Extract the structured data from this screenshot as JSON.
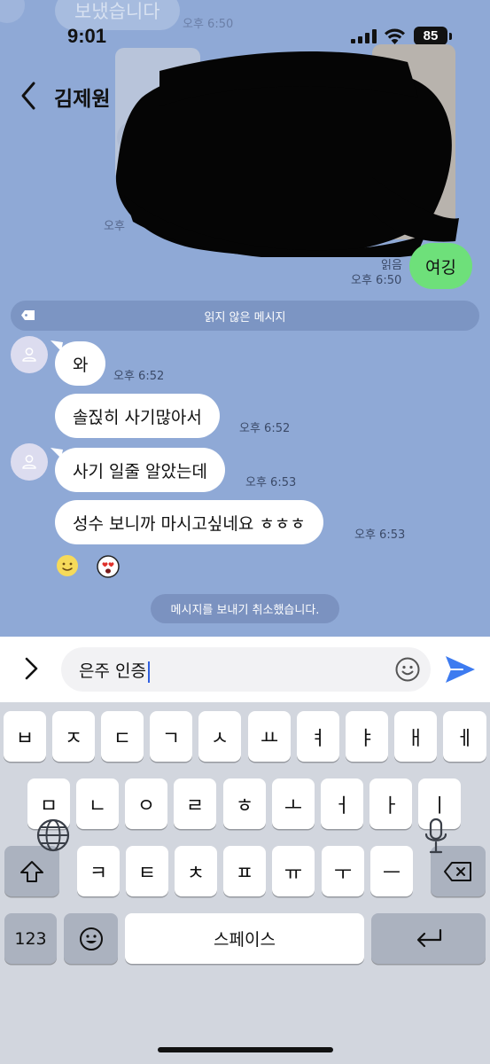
{
  "status_bar": {
    "time": "9:01",
    "battery": "85"
  },
  "header": {
    "title": "김제원"
  },
  "background_faint": {
    "top_bubble_text": "보냈습니다",
    "top_time": "오후 6:50",
    "left_time": "오후"
  },
  "sent_message": {
    "read_label": "읽음",
    "time": "오후 6:50",
    "text": "여깅"
  },
  "unread_divider": "읽지 않은 메시지",
  "messages": [
    {
      "text": "와",
      "time": "오후 6:52"
    },
    {
      "text": "솔짅히 사기많아서",
      "time": "오후 6:52"
    },
    {
      "text": "사기 일줄 알았는데",
      "time": "오후 6:53"
    },
    {
      "text": "성수 보니까 마시고싶네요 ㅎㅎㅎ",
      "time": "오후 6:53"
    }
  ],
  "reactions": [
    "smile-emoji",
    "heart-eyes-emoji"
  ],
  "system_notice": "메시지를 보내기 취소했습니다.",
  "composer": {
    "value": "은주 인증"
  },
  "keyboard": {
    "row1": [
      "ㅂ",
      "ㅈ",
      "ㄷ",
      "ㄱ",
      "ㅅ",
      "ㅛ",
      "ㅕ",
      "ㅑ",
      "ㅐ",
      "ㅔ"
    ],
    "row2": [
      "ㅁ",
      "ㄴ",
      "ㅇ",
      "ㄹ",
      "ㅎ",
      "ㅗ",
      "ㅓ",
      "ㅏ",
      "ㅣ"
    ],
    "row3": [
      "ㅋ",
      "ㅌ",
      "ㅊ",
      "ㅍ",
      "ㅠ",
      "ㅜ",
      "ㅡ"
    ],
    "numbers_key": "123",
    "space_key": "스페이스"
  },
  "colors": {
    "chat_background": "#8fa9d6",
    "sent_bubble": "#6ee07a",
    "send_accent": "#3d7bf0",
    "keyboard_background": "#d2d6de"
  }
}
